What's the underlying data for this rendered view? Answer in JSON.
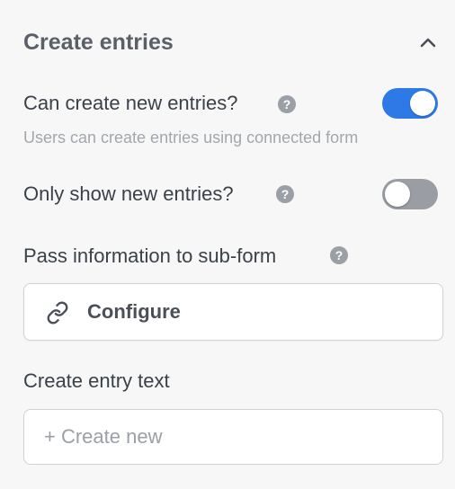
{
  "section": {
    "title": "Create entries",
    "collapse_icon": "chevron-up-icon"
  },
  "can_create": {
    "label": "Can create new entries?",
    "help_icon": "question-icon",
    "help_glyph": "?",
    "toggle_state": "on",
    "hint": "Users can create entries using connected form"
  },
  "only_show_new": {
    "label": "Only show new entries?",
    "help_icon": "question-icon",
    "help_glyph": "?",
    "toggle_state": "off"
  },
  "pass_info": {
    "label": "Pass information to sub-form",
    "help_icon": "question-icon",
    "help_glyph": "?",
    "button_icon": "link-icon",
    "button_label": "Configure"
  },
  "entry_text": {
    "label": "Create entry text",
    "placeholder": "+ Create new",
    "value": ""
  },
  "colors": {
    "toggle_on": "#2d7ae6",
    "toggle_off": "#9a9ea4",
    "background": "#f7f7f8"
  }
}
